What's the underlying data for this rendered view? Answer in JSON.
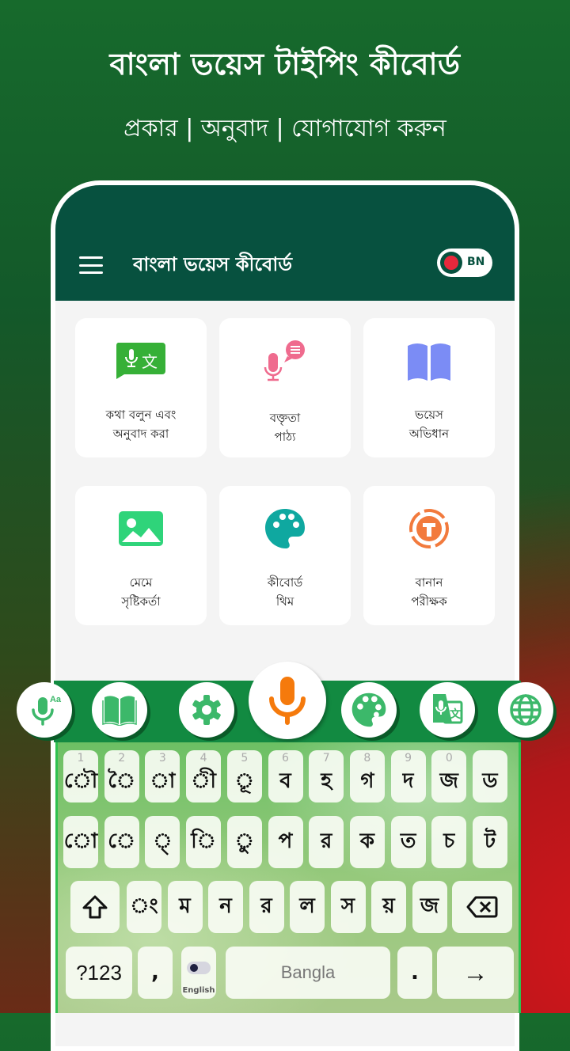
{
  "hero": {
    "title": "বাংলা ভয়েস টাইপিং কীবোর্ড",
    "subtitle": "প্রকার | অনুবাদ | যোগাযোগ করুন"
  },
  "appbar": {
    "menu_icon": "hamburger-menu-icon",
    "title": "বাংলা ভয়েস কীবোর্ড",
    "language_toggle": "BN"
  },
  "features": [
    {
      "icon": "speak-translate-icon",
      "color": "#36b037",
      "line1": "কথা বলুন এবং",
      "line2": "অনুবাদ করা"
    },
    {
      "icon": "speech-text-icon",
      "color": "#ef6b8e",
      "line1": "বক্তৃতা",
      "line2": "পাঠ্য"
    },
    {
      "icon": "voice-dictionary-icon",
      "color": "#7b8cf5",
      "line1": "ভয়েস",
      "line2": "অভিধান"
    },
    {
      "icon": "meme-image-icon",
      "color": "#2fd47a",
      "line1": "মেমে",
      "line2": "সৃষ্টিকর্তা"
    },
    {
      "icon": "palette-icon",
      "color": "#0fa8a0",
      "line1": "কীবোর্ড",
      "line2": "থিম"
    },
    {
      "icon": "spell-check-icon",
      "color": "#f27a3d",
      "line1": "বানান",
      "line2": "পরীক্ষক"
    }
  ],
  "toolbar": {
    "buttons": [
      "voice-typing-icon",
      "dictionary-icon",
      "settings-icon",
      "mic-icon",
      "theme-palette-icon",
      "voice-translate-icon",
      "globe-icon"
    ],
    "accent": "#3cb86a",
    "mic_color": "#f57a0c"
  },
  "keyboard": {
    "row1": [
      {
        "num": "1",
        "ch": "ৌ"
      },
      {
        "num": "2",
        "ch": "ৈ"
      },
      {
        "num": "3",
        "ch": "া"
      },
      {
        "num": "4",
        "ch": "ী"
      },
      {
        "num": "5",
        "ch": "ূ"
      },
      {
        "num": "6",
        "ch": "ব"
      },
      {
        "num": "7",
        "ch": "হ"
      },
      {
        "num": "8",
        "ch": "গ"
      },
      {
        "num": "9",
        "ch": "দ"
      },
      {
        "num": "0",
        "ch": "জ"
      },
      {
        "num": "",
        "ch": "ড"
      }
    ],
    "row2": [
      "ো",
      "ে",
      "্",
      "ি",
      "ু",
      "প",
      "র",
      "ক",
      "ত",
      "চ",
      "ট"
    ],
    "row3": [
      "ং",
      "ম",
      "ন",
      "র",
      "ল",
      "স",
      "য়",
      "জ"
    ],
    "shift": "⇧",
    "backspace": "⌫",
    "row4": {
      "symbols": "?123",
      "comma": ",",
      "english_label": "English",
      "space": "Bangla",
      "period": ".",
      "enter": "→"
    }
  }
}
